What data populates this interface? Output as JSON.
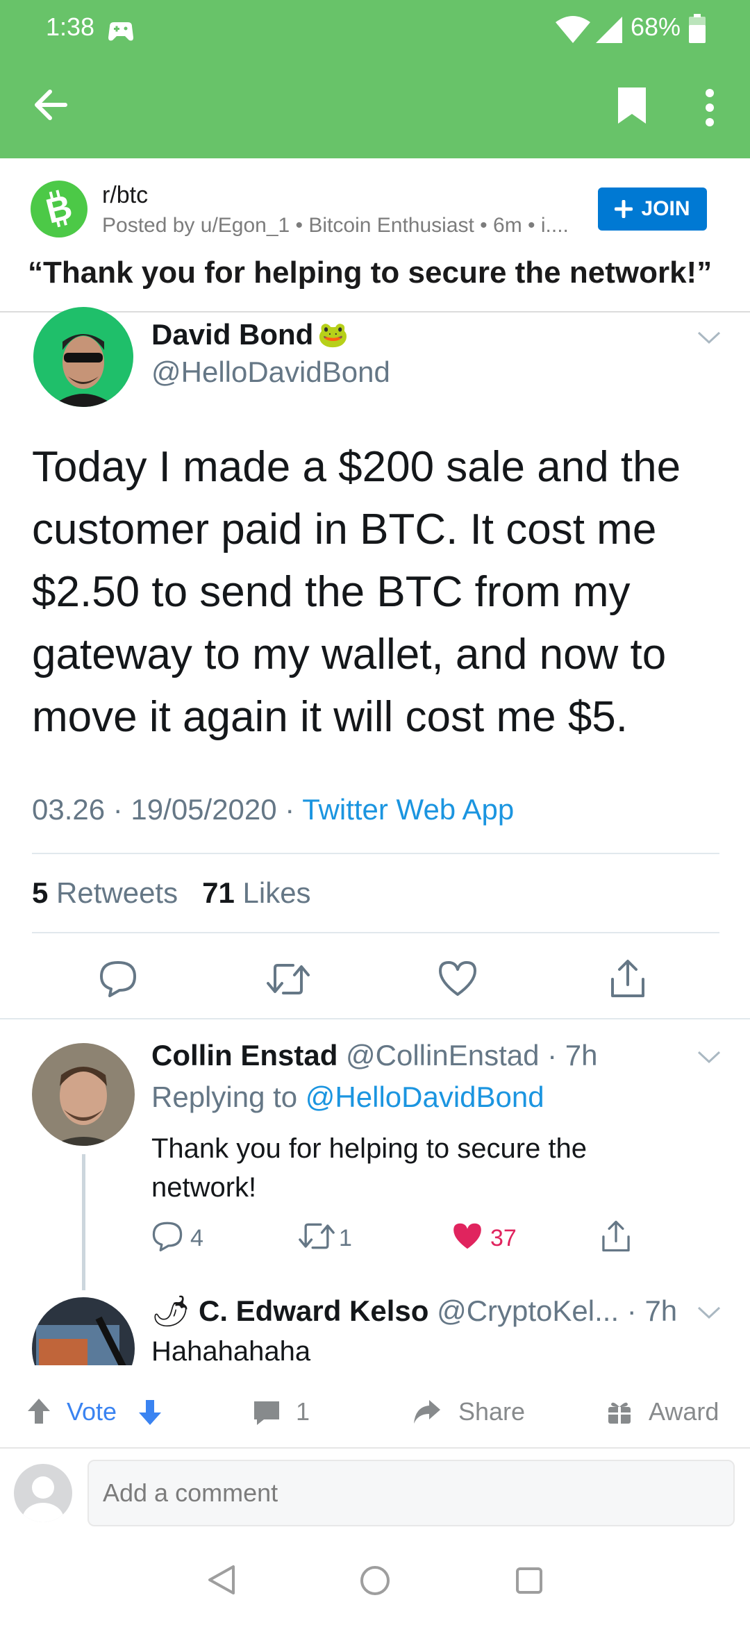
{
  "status_bar": {
    "time": "1:38",
    "battery": "68%"
  },
  "toolbar": {
    "back_icon": "arrow-left-icon",
    "bookmark_icon": "bookmark-icon",
    "more_icon": "more-vertical-icon"
  },
  "post": {
    "subreddit": "r/btc",
    "meta": "Posted by u/Egon_1 • Bitcoin Enthusiast • 6m • i....",
    "join_label": "JOIN",
    "title": "“Thank you for helping to secure the network!”"
  },
  "tweet": {
    "name": "David Bond",
    "name_emoji": "🐸",
    "handle": "@HelloDavidBond",
    "body": "Today I made a $200 sale and the customer paid in BTC. It cost me $2.50 to send the BTC from my gateway to my wallet, and now to move it again it will cost me $5.",
    "timestamp": "03.26 · 19/05/2020 · ",
    "via": "Twitter Web App",
    "retweets_count": "5",
    "retweets_label": " Retweets",
    "likes_count": "71",
    "likes_label": " Likes"
  },
  "reply": {
    "name": "Collin Enstad",
    "handle_time": " @CollinEnstad · 7h",
    "replying_prefix": "Replying to ",
    "replying_handle": "@HelloDavidBond",
    "text": "Thank you for helping to secure the network!",
    "replies": "4",
    "retweets": "1",
    "likes": "37"
  },
  "reply2": {
    "emoji": "🌶",
    "name": "C. Edward Kelso",
    "handle_time": " @CryptoKel... · 7h",
    "text": "Hahahahaha"
  },
  "action_bar": {
    "vote_label": "Vote",
    "comments_count": "1",
    "share_label": "Share",
    "award_label": "Award"
  },
  "comment_box": {
    "placeholder": "Add a comment"
  },
  "colors": {
    "header_green": "#68c369",
    "join_blue": "#0079d3",
    "twitter_blue": "#1b95e0",
    "like_red": "#e0245e",
    "vote_blue": "#3a83f1"
  }
}
